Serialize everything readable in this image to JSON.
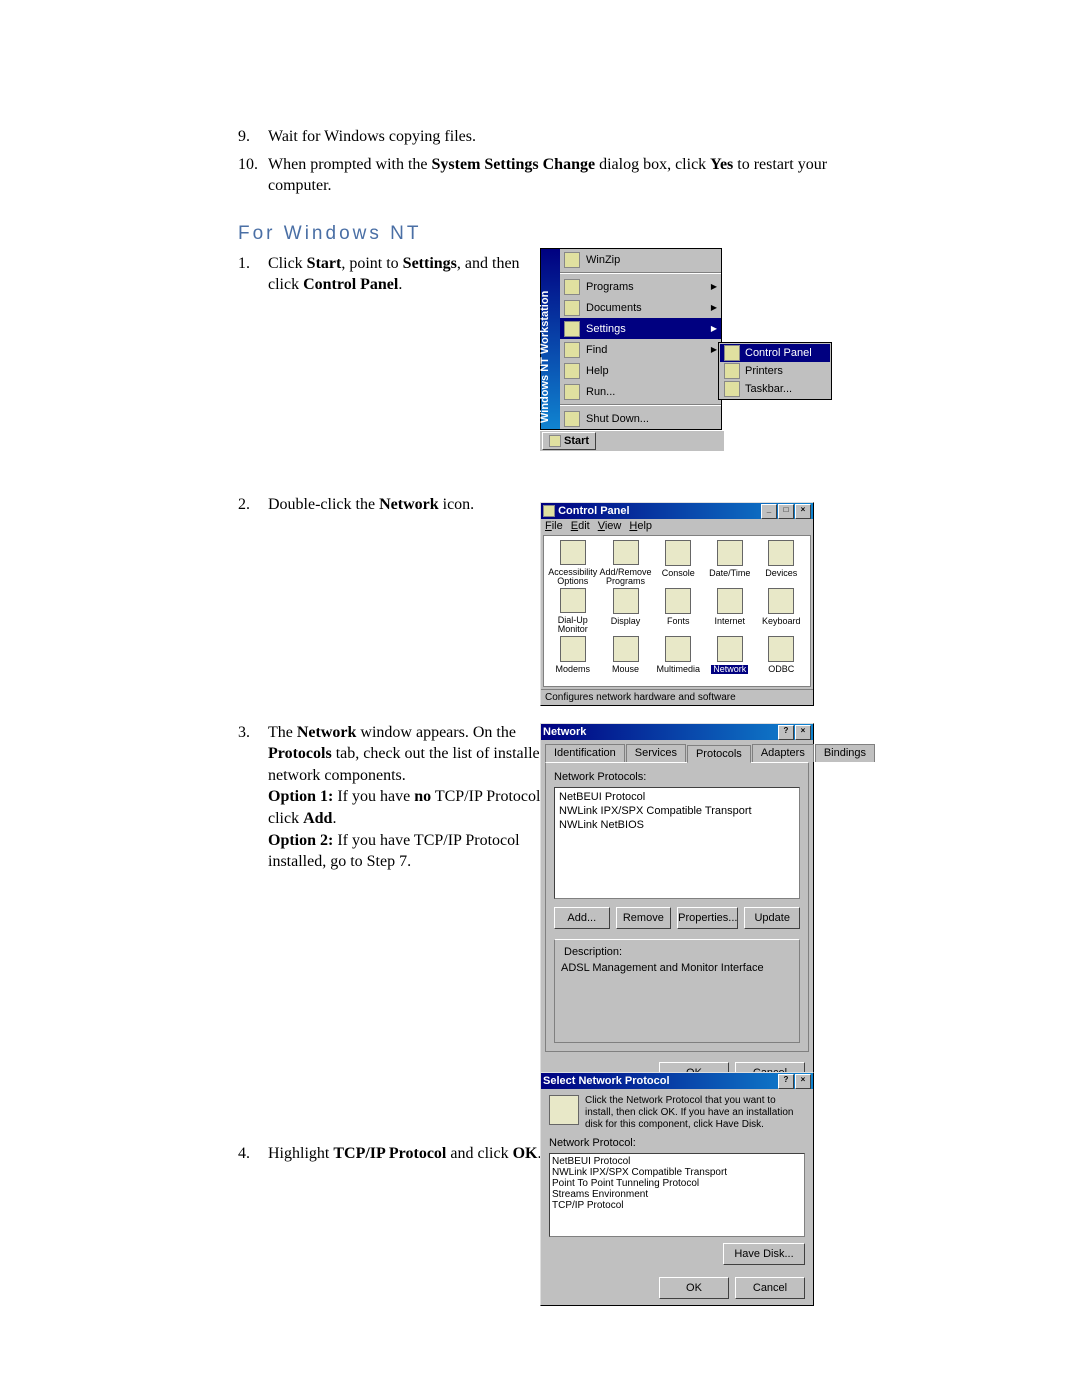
{
  "list_top": {
    "item9_num": "9.",
    "item9": "Wait for Windows copying files.",
    "item10_num": "10.",
    "item10_a": "When prompted with the ",
    "item10_b": "System Settings Change",
    "item10_c": " dialog box, click ",
    "item10_d": "Yes",
    "item10_e": " to restart your computer."
  },
  "section_title": "For Windows NT",
  "steps": {
    "s1_num": "1.",
    "s1_a": "Click ",
    "s1_b": "Start",
    "s1_c": ", point to ",
    "s1_d": "Settings",
    "s1_e": ", and then click ",
    "s1_f": "Control Panel",
    "s1_g": ".",
    "s2_num": "2.",
    "s2_a": "Double-click the ",
    "s2_b": "Network",
    "s2_c": " icon.",
    "s3_num": "3.",
    "s3_a": "The ",
    "s3_b": "Network",
    "s3_c": " window appears. On the ",
    "s3_d": "Protocols",
    "s3_e": " tab, check out the list of installed network components.",
    "s3_f": "Option 1:",
    "s3_g": " If you have ",
    "s3_h": "no",
    "s3_i": " TCP/IP Protocol, click ",
    "s3_j": "Add",
    "s3_k": ".",
    "s3_l": "Option 2:",
    "s3_m": " If you have TCP/IP Protocol installed, go to Step 7.",
    "s4_num": "4.",
    "s4_a": "Highlight ",
    "s4_b": "TCP/IP Protocol",
    "s4_c": " and click ",
    "s4_d": "OK",
    "s4_e": "."
  },
  "startmenu": {
    "band": "Windows NT Workstation",
    "items": [
      "WinZip",
      "Programs",
      "Documents",
      "Settings",
      "Find",
      "Help",
      "Run...",
      "Shut Down..."
    ],
    "start": "Start",
    "sub": {
      "cp": "Control Panel",
      "printers": "Printers",
      "taskbar": "Taskbar..."
    }
  },
  "cp": {
    "title": "Control Panel",
    "menu": [
      "File",
      "Edit",
      "View",
      "Help"
    ],
    "icons": [
      "Accessibility Options",
      "Add/Remove Programs",
      "Console",
      "Date/Time",
      "Devices",
      "Dial-Up Monitor",
      "Display",
      "Fonts",
      "Internet",
      "Keyboard",
      "Modems",
      "Mouse",
      "Multimedia",
      "Network",
      "ODBC"
    ],
    "status": "Configures network hardware and software"
  },
  "network": {
    "title": "Network",
    "tabs": [
      "Identification",
      "Services",
      "Protocols",
      "Adapters",
      "Bindings"
    ],
    "list_label": "Network Protocols:",
    "items": [
      "NetBEUI Protocol",
      "NWLink IPX/SPX Compatible Transport",
      "NWLink NetBIOS"
    ],
    "btns": [
      "Add...",
      "Remove",
      "Properties...",
      "Update"
    ],
    "desc_label": "Description:",
    "desc": "ADSL Management and Monitor Interface",
    "ok": "OK",
    "cancel": "Cancel"
  },
  "select": {
    "title": "Select Network Protocol",
    "instr": "Click the Network Protocol that you want to install, then click OK. If you have an installation disk for this component, click Have Disk.",
    "list_label": "Network Protocol:",
    "items": [
      "NetBEUI Protocol",
      "NWLink IPX/SPX Compatible Transport",
      "Point To Point Tunneling Protocol",
      "Streams Environment",
      "TCP/IP Protocol"
    ],
    "havedisk": "Have Disk...",
    "ok": "OK",
    "cancel": "Cancel"
  }
}
